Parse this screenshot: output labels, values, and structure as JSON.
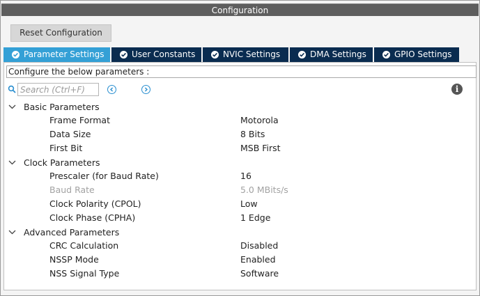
{
  "window": {
    "title": "Configuration"
  },
  "toolbar": {
    "reset_label": "Reset Configuration"
  },
  "tabs": [
    {
      "label": "Parameter Settings",
      "active": true
    },
    {
      "label": "User Constants",
      "active": false
    },
    {
      "label": "NVIC Settings",
      "active": false
    },
    {
      "label": "DMA Settings",
      "active": false
    },
    {
      "label": "GPIO Settings",
      "active": false
    }
  ],
  "panel": {
    "description": "Configure the below parameters :",
    "search": {
      "placeholder": "Search (Ctrl+F)",
      "value": ""
    }
  },
  "icons": {
    "search": "search-icon",
    "prev": "chevron-left-circle-icon",
    "next": "chevron-right-circle-icon",
    "info": "info-icon",
    "collapse": "chevron-down-icon",
    "tab_check": "check-circle-icon"
  },
  "colors": {
    "tab_active": "#34a0d6",
    "tab_inactive": "#0a2c50",
    "title_bar": "#5e5e5e",
    "disabled_text": "#a2a2a2"
  },
  "groups": [
    {
      "label": "Basic Parameters",
      "params": [
        {
          "name": "Frame Format",
          "value": "Motorola",
          "disabled": false
        },
        {
          "name": "Data Size",
          "value": "8 Bits",
          "disabled": false
        },
        {
          "name": "First Bit",
          "value": "MSB First",
          "disabled": false
        }
      ]
    },
    {
      "label": "Clock Parameters",
      "params": [
        {
          "name": "Prescaler (for Baud Rate)",
          "value": "16",
          "disabled": false
        },
        {
          "name": "Baud Rate",
          "value": "5.0 MBits/s",
          "disabled": true
        },
        {
          "name": "Clock Polarity (CPOL)",
          "value": "Low",
          "disabled": false
        },
        {
          "name": "Clock Phase (CPHA)",
          "value": "1 Edge",
          "disabled": false
        }
      ]
    },
    {
      "label": "Advanced Parameters",
      "params": [
        {
          "name": "CRC Calculation",
          "value": "Disabled",
          "disabled": false
        },
        {
          "name": "NSSP Mode",
          "value": "Enabled",
          "disabled": false
        },
        {
          "name": "NSS Signal Type",
          "value": "Software",
          "disabled": false
        }
      ]
    }
  ]
}
